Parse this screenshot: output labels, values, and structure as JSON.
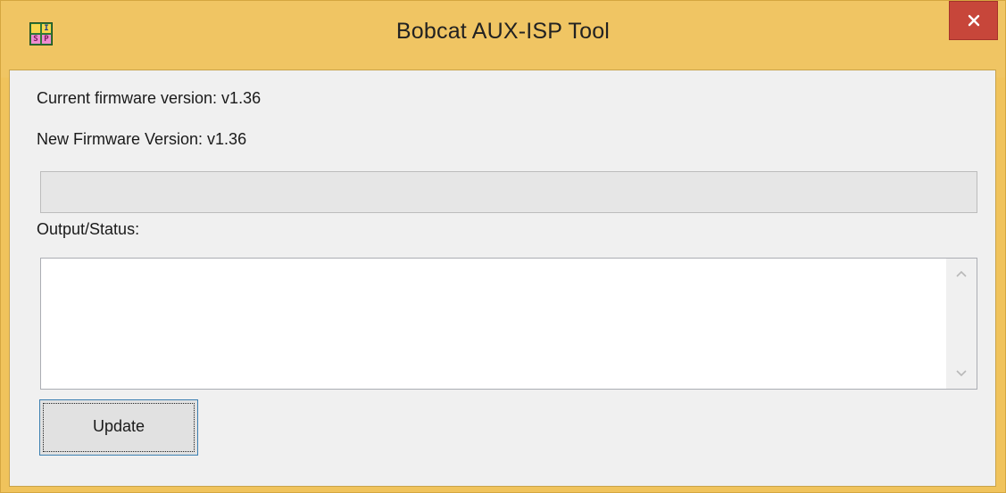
{
  "window": {
    "title": "Bobcat AUX-ISP Tool",
    "icon": "app-isp-icon",
    "icon_letters": [
      "I",
      "S",
      "P"
    ],
    "close_icon": "close-icon",
    "frame_color": "#f0c563",
    "close_color": "#c7463a"
  },
  "main": {
    "current_firmware_label": "Current firmware version: v1.36",
    "new_firmware_label": "New Firmware Version: v1.36",
    "progress": {
      "value_percent": 0
    },
    "output_label": "Output/Status:",
    "output_text": "",
    "update_button_label": "Update"
  }
}
